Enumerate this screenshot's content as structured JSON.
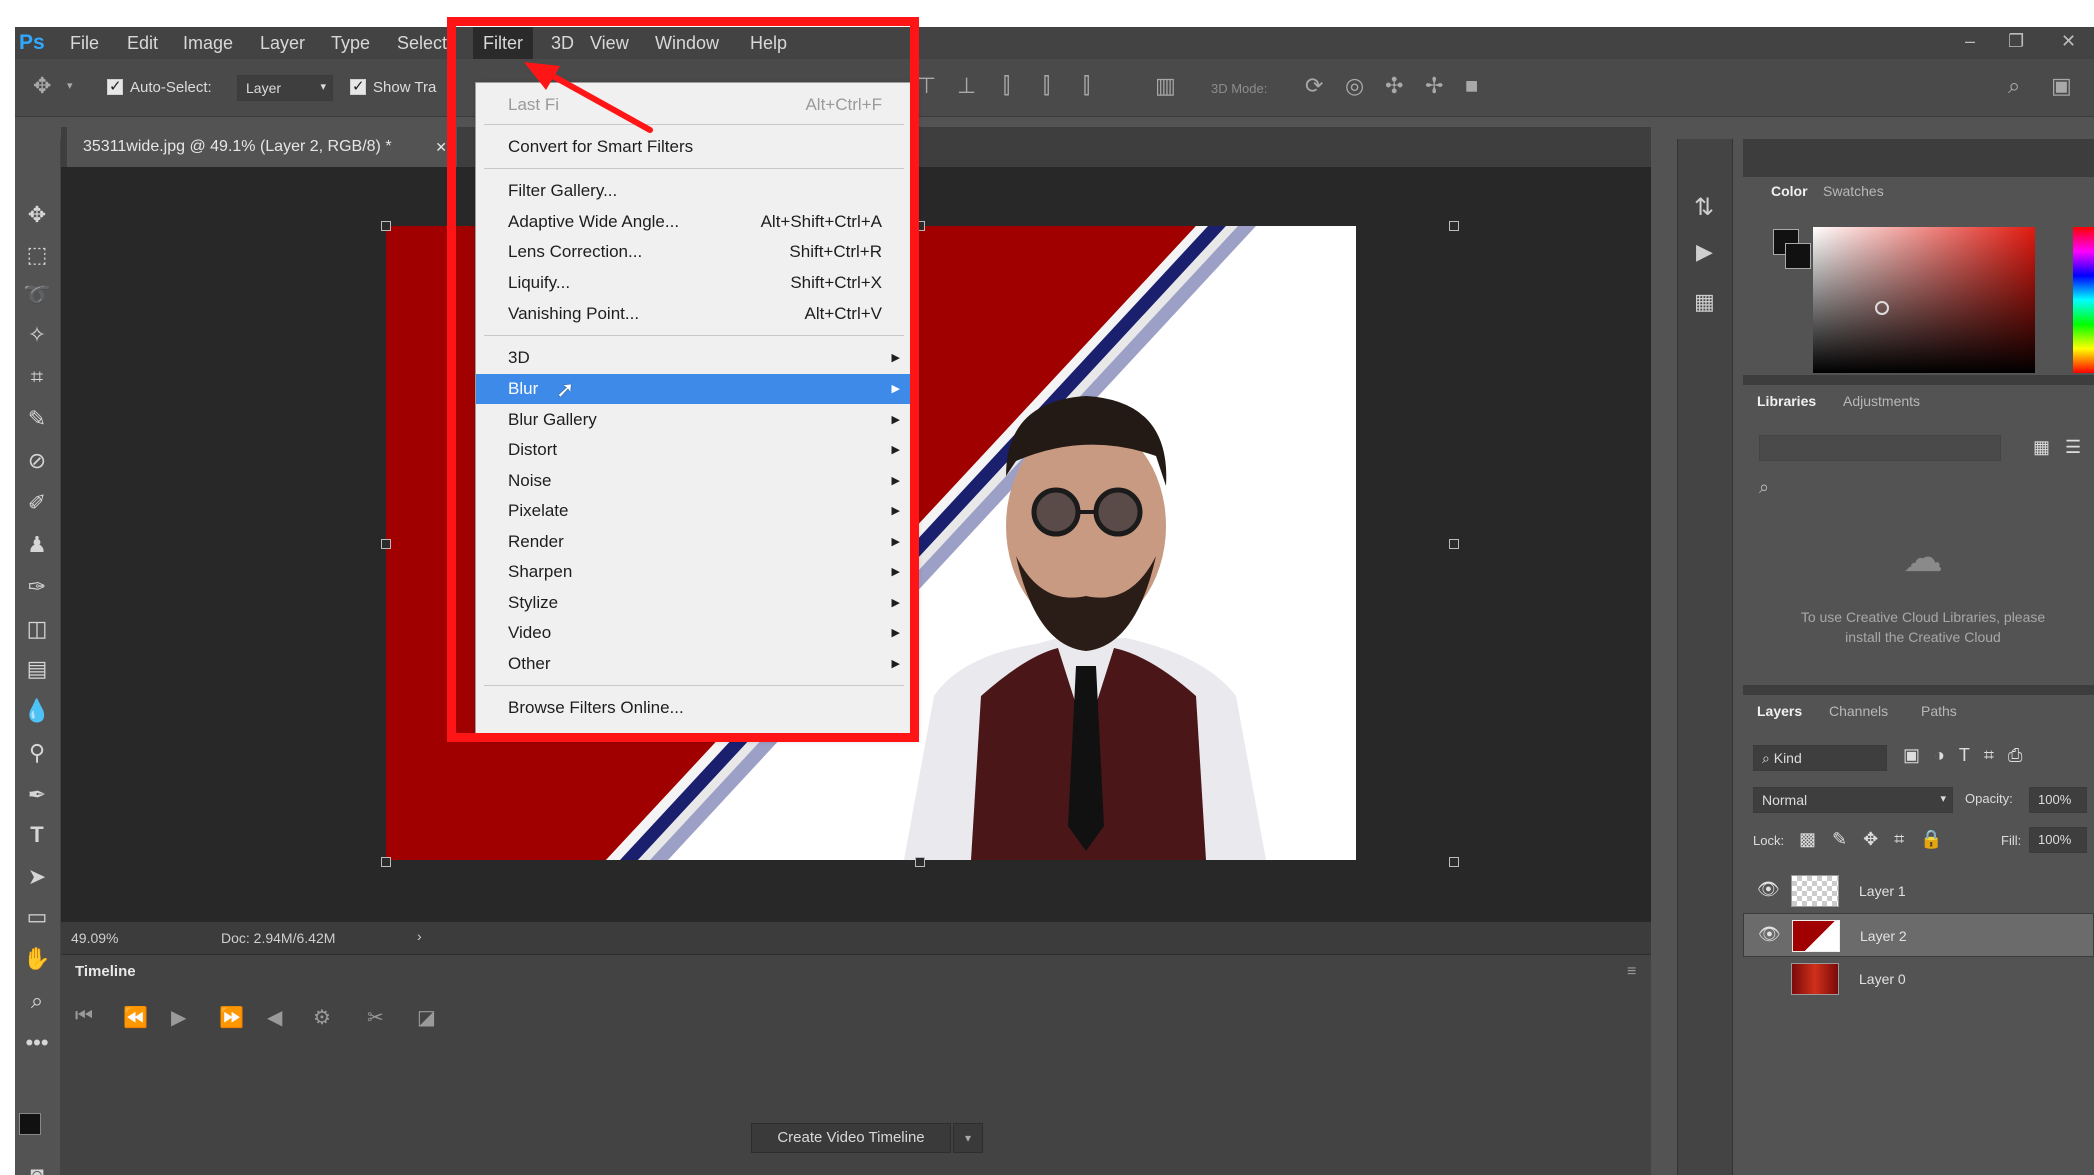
{
  "app": {
    "logo": "Ps"
  },
  "menubar": {
    "items": [
      "File",
      "Edit",
      "Image",
      "Layer",
      "Type",
      "Select",
      "Filter",
      "3D",
      "View",
      "Window",
      "Help"
    ],
    "active": "Filter"
  },
  "options": {
    "auto_select_label": "Auto-Select:",
    "auto_select_value": "Layer",
    "show_transform_label": "Show Tra",
    "mode_3d_label": "3D Mode:"
  },
  "document": {
    "tab_title": "35311wide.jpg @ 49.1% (Layer 2, RGB/8) *",
    "zoom": "49.09%",
    "doc_info": "Doc: 2.94M/6.42M"
  },
  "timeline": {
    "tab_label": "Timeline",
    "create_button": "Create Video Timeline"
  },
  "filter_menu": {
    "items": [
      {
        "label": "Last Fi",
        "shortcut": "Alt+Ctrl+F",
        "disabled": true
      },
      {
        "label": "Convert for Smart Filters",
        "shortcut": ""
      },
      {
        "label": "Filter Gallery...",
        "shortcut": ""
      },
      {
        "label": "Adaptive Wide Angle...",
        "shortcut": "Alt+Shift+Ctrl+A"
      },
      {
        "label": "Lens Correction...",
        "shortcut": "Shift+Ctrl+R"
      },
      {
        "label": "Liquify...",
        "shortcut": "Shift+Ctrl+X"
      },
      {
        "label": "Vanishing Point...",
        "shortcut": "Alt+Ctrl+V"
      },
      {
        "label": "3D",
        "submenu": true
      },
      {
        "label": "Blur",
        "submenu": true,
        "highlighted": true
      },
      {
        "label": "Blur Gallery",
        "submenu": true
      },
      {
        "label": "Distort",
        "submenu": true
      },
      {
        "label": "Noise",
        "submenu": true
      },
      {
        "label": "Pixelate",
        "submenu": true
      },
      {
        "label": "Render",
        "submenu": true
      },
      {
        "label": "Sharpen",
        "submenu": true
      },
      {
        "label": "Stylize",
        "submenu": true
      },
      {
        "label": "Video",
        "submenu": true
      },
      {
        "label": "Other",
        "submenu": true
      },
      {
        "label": "Browse Filters Online...",
        "shortcut": ""
      }
    ]
  },
  "right_panels": {
    "color_tabs": [
      "Color",
      "Swatches"
    ],
    "library_tabs": [
      "Libraries",
      "Adjustments"
    ],
    "library_message": "To use Creative Cloud Libraries, please install the Creative Cloud",
    "layer_tabs": [
      "Layers",
      "Channels",
      "Paths"
    ],
    "kind_filter": "Kind",
    "blend_mode": "Normal",
    "opacity_label": "Opacity:",
    "opacity_value": "100%",
    "lock_label": "Lock:",
    "fill_label": "Fill:",
    "fill_value": "100%",
    "layers": [
      "Layer 1",
      "Layer 2",
      "Layer 0"
    ],
    "selected_layer": "Layer 2"
  },
  "colors": {
    "highlight": "#3d8ae9",
    "annotation": "#ff1515",
    "canvas_red": "#a10000"
  }
}
